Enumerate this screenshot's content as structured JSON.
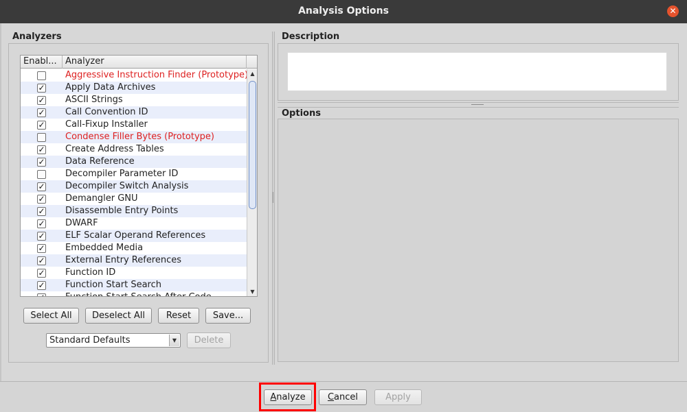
{
  "window": {
    "title": "Analysis Options"
  },
  "analyzers": {
    "title": "Analyzers",
    "columns": [
      "Enabl...",
      "Analyzer"
    ],
    "rows": [
      {
        "name": "Aggressive Instruction Finder (Prototype)",
        "enabled": false,
        "prototype": true
      },
      {
        "name": "Apply Data Archives",
        "enabled": true,
        "prototype": false
      },
      {
        "name": "ASCII Strings",
        "enabled": true,
        "prototype": false
      },
      {
        "name": "Call Convention ID",
        "enabled": true,
        "prototype": false
      },
      {
        "name": "Call-Fixup Installer",
        "enabled": true,
        "prototype": false
      },
      {
        "name": "Condense Filler Bytes (Prototype)",
        "enabled": false,
        "prototype": true
      },
      {
        "name": "Create Address Tables",
        "enabled": true,
        "prototype": false
      },
      {
        "name": "Data Reference",
        "enabled": true,
        "prototype": false
      },
      {
        "name": "Decompiler Parameter ID",
        "enabled": false,
        "prototype": false
      },
      {
        "name": "Decompiler Switch Analysis",
        "enabled": true,
        "prototype": false
      },
      {
        "name": "Demangler GNU",
        "enabled": true,
        "prototype": false
      },
      {
        "name": "Disassemble Entry Points",
        "enabled": true,
        "prototype": false
      },
      {
        "name": "DWARF",
        "enabled": true,
        "prototype": false
      },
      {
        "name": "ELF Scalar Operand References",
        "enabled": true,
        "prototype": false
      },
      {
        "name": "Embedded Media",
        "enabled": true,
        "prototype": false
      },
      {
        "name": "External Entry References",
        "enabled": true,
        "prototype": false
      },
      {
        "name": "Function ID",
        "enabled": true,
        "prototype": false
      },
      {
        "name": "Function Start Search",
        "enabled": true,
        "prototype": false
      },
      {
        "name": "Function Start Search After Code",
        "enabled": true,
        "prototype": false
      }
    ],
    "buttons": {
      "select_all": "Select All",
      "deselect_all": "Deselect All",
      "reset": "Reset",
      "save": "Save..."
    },
    "profile_select": "Standard Defaults",
    "delete_button": "Delete"
  },
  "description": {
    "title": "Description",
    "text": ""
  },
  "options": {
    "title": "Options"
  },
  "footer": {
    "analyze_mnemonic": "A",
    "analyze_rest": "nalyze",
    "cancel_mnemonic": "C",
    "cancel_rest": "ancel",
    "apply": "Apply"
  },
  "icons": {
    "close": "close-icon",
    "scroll_up": "scroll-up-arrow-icon",
    "scroll_down": "scroll-down-arrow-icon",
    "dropdown": "chevron-down-icon",
    "checkmark": "checkmark-icon"
  },
  "colors": {
    "prototype_text": "#dd1f1f",
    "close_button": "#e5532d",
    "highlight_border": "#ff0000"
  }
}
